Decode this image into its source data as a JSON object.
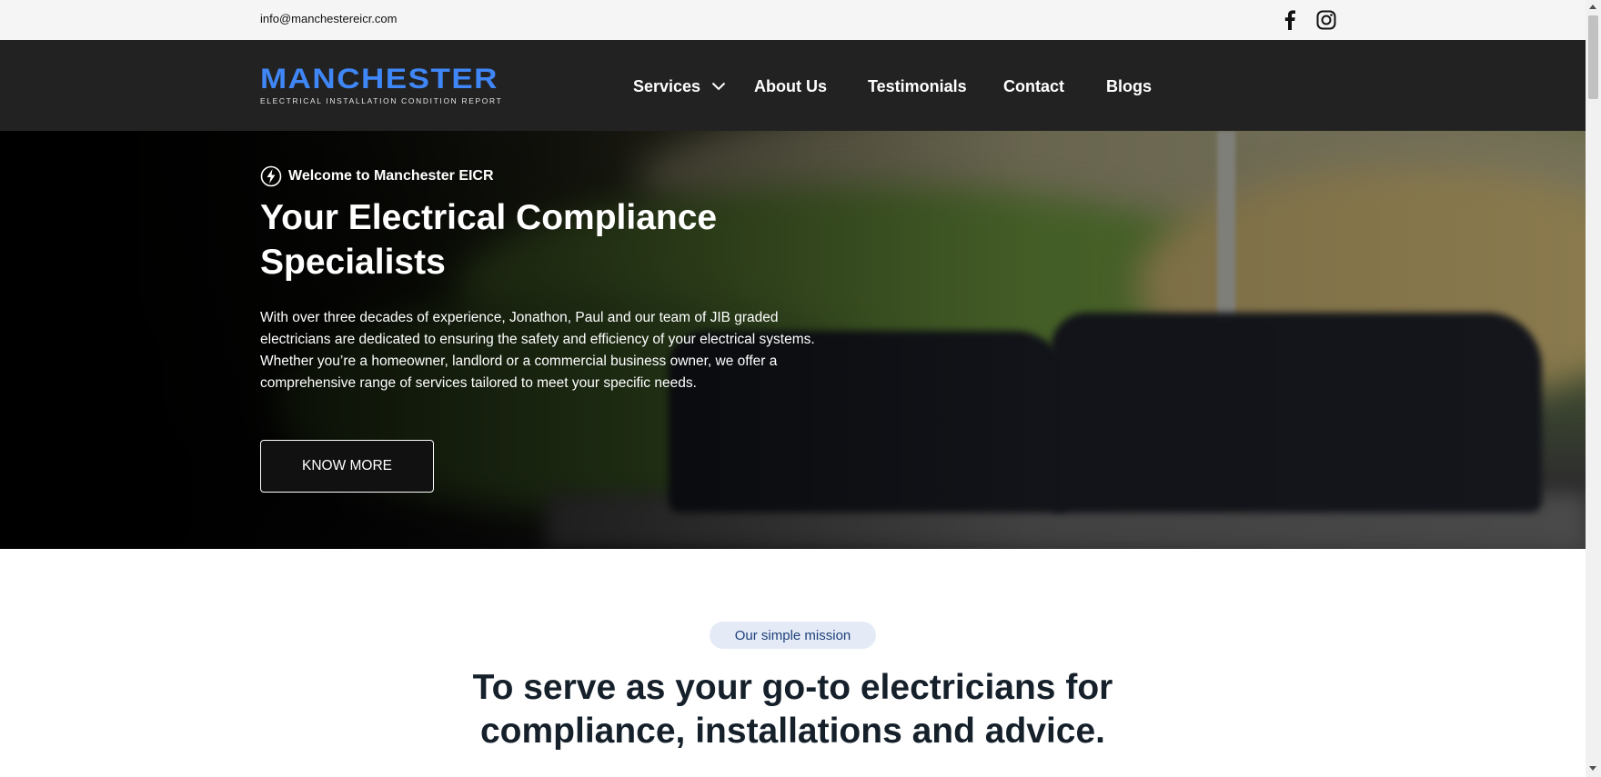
{
  "topbar": {
    "email": "info@manchestereicr.com",
    "social": [
      "facebook-icon",
      "instagram-icon"
    ]
  },
  "logo": {
    "word": "MANCHESTER",
    "subtitle": "ELECTRICAL INSTALLATION CONDITION REPORT"
  },
  "nav": {
    "items": [
      {
        "label": "Services",
        "has_dropdown": true
      },
      {
        "label": "About Us"
      },
      {
        "label": "Testimonials"
      },
      {
        "label": "Contact"
      },
      {
        "label": "Blogs"
      }
    ]
  },
  "hero": {
    "eyebrow": "Welcome to Manchester EICR",
    "title": "Your Electrical Compliance Specialists",
    "text": "With over three decades of experience, Jonathon, Paul and our team of JIB graded electricians are dedicated to ensuring the safety and efficiency of your electrical systems. Whether you’re a homeowner, landlord or a commercial business owner, we offer a comprehensive range of services tailored to meet your specific needs.",
    "button_label": "KNOW MORE"
  },
  "mission": {
    "badge": "Our simple mission",
    "title": "To serve as your go-to electricians for compliance, installations and advice."
  },
  "colors": {
    "brand_blue": "#3f86f6",
    "nav_bg": "#222222",
    "topbar_bg": "#f5f5f5",
    "badge_bg": "#e4ebf6",
    "badge_text": "#1e3f7a",
    "heading_dark": "#15202b"
  }
}
